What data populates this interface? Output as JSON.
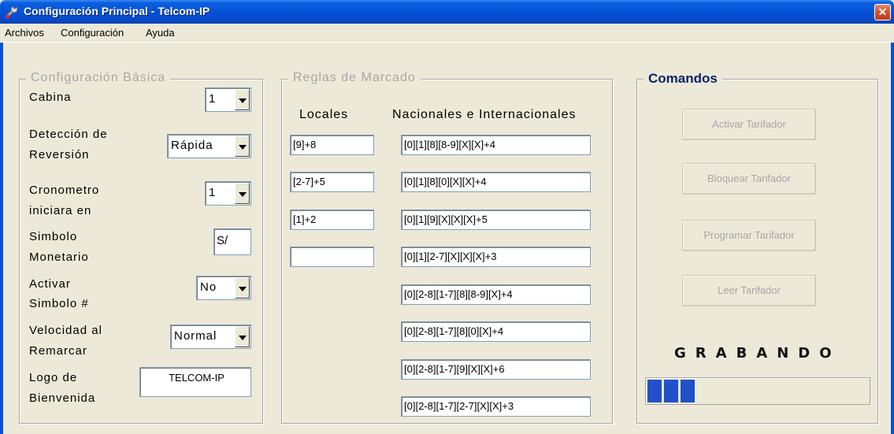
{
  "window": {
    "title": "Configuración Principal - Telcom-IP",
    "close_glyph": "✕"
  },
  "menu": [
    "Archivos",
    "Configuración",
    "Ayuda"
  ],
  "basic": {
    "legend": "Configuración Básica",
    "cabina": {
      "label": "Cabina",
      "value": "1"
    },
    "deteccion": {
      "label1": "Detección de",
      "label2": "Reversión",
      "value": "Rápida"
    },
    "cronometro": {
      "label1": "Cronometro",
      "label2": "iniciara en",
      "value": "1"
    },
    "simbolo": {
      "label1": "Simbolo",
      "label2": "Monetario",
      "value": "S/"
    },
    "activar": {
      "label1": "Activar",
      "label2": "Simbolo #",
      "value": "No"
    },
    "velocidad": {
      "label1": "Velocidad al",
      "label2": "Remarcar",
      "value": "Normal"
    },
    "logo": {
      "label1": "Logo de",
      "label2": "Bienvenida",
      "value": "TELCOM-IP"
    }
  },
  "rules": {
    "legend": "Reglas de Marcado",
    "locales_header": "Locales",
    "nacionales_header": "Nacionales e Internacionales",
    "locales": [
      "[9]+8",
      "[2-7]+5",
      "[1]+2",
      ""
    ],
    "nacionales": [
      "[0][1][8][8-9][X][X]+4",
      "[0][1][8][0][X][X]+4",
      "[0][1][9][X][X][X]+5",
      "[0][1][2-7][X][X][X]+3",
      "[0][2-8][1-7][8][8-9][X]+4",
      "[0][2-8][1-7][8][0][X]+4",
      "[0][2-8][1-7][9][X][X]+6",
      "[0][2-8][1-7][2-7][X][X]+3"
    ]
  },
  "commands": {
    "legend": "Comandos",
    "buttons": [
      "Activar Tarifador",
      "Bloquear Tarifador",
      "Programar Tarifador",
      "Leer Tarifador"
    ],
    "status": "GRABANDO",
    "progress_fraction": 0.24
  },
  "colors": {
    "titlebar": "#0453D6",
    "legend_active": "#0A246A",
    "disabled_text": "#A7A6AA",
    "progress": "#2151C9"
  },
  "icons": {
    "app": "wrench-icon",
    "close": "close-icon",
    "dropdown": "chevron-down-icon"
  }
}
